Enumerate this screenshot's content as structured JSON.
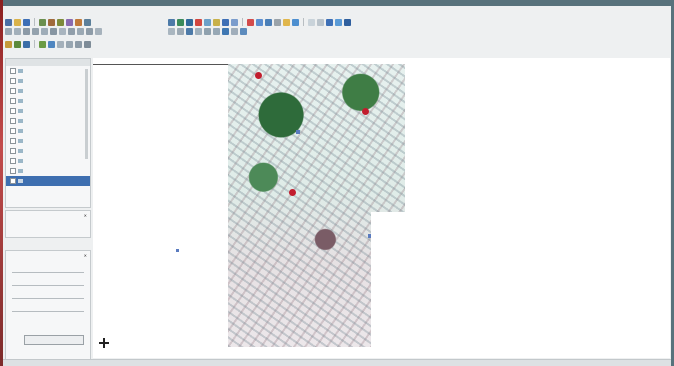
{
  "menubar": {
    "items": []
  },
  "layers_panel": {
    "title": "",
    "layers": []
  },
  "browser_panel": {
    "title": ""
  },
  "processing_panel": {
    "title": "",
    "run_label": ""
  },
  "map_labels": [],
  "status": {
    "left": "",
    "right": ""
  },
  "colors": {
    "frame": "#58727c",
    "selection": "#3e6fb0",
    "pin": "#c21d2e"
  }
}
